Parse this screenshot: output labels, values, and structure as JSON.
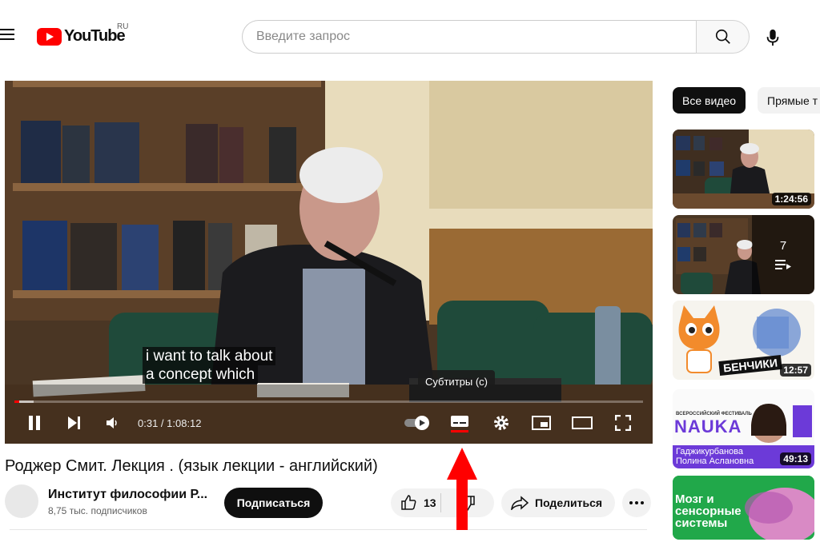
{
  "header": {
    "logo_text": "YouTube",
    "country_code": "RU",
    "search_placeholder": "Введите запрос"
  },
  "player": {
    "subtitle_line1": "i want to talk about",
    "subtitle_line2": "a concept which",
    "tooltip": "Субтитры (c)",
    "time_display": "0:31 / 1:08:12",
    "progress_fraction": 0.0076,
    "colors": {
      "progress": "#ff0000",
      "captions_active": "#ff0000"
    }
  },
  "video": {
    "title": "Роджер Смит. Лекция . (язык лекции - английский)",
    "channel_name": "Институт философии Р...",
    "subscribers": "8,75 тыс. подписчиков",
    "subscribe_label": "Подписаться",
    "likes": "13",
    "share_label": "Поделиться"
  },
  "sidebar": {
    "chips": [
      "Все видео",
      "Прямые т"
    ],
    "items": [
      {
        "duration": "1:24:56"
      },
      {
        "playlist_count": "7"
      },
      {
        "duration": "12:57",
        "caption": "БЕНЧИКИ"
      },
      {
        "duration": "49:13",
        "title": "NAUKA",
        "names": "Гаджикурбанова Полина Аслановна",
        "festival": "ВСЕРОССИЙСКИЙ ФЕСТИВАЛЬ"
      },
      {
        "caption": "Мозг и сенсорные системы"
      }
    ]
  }
}
